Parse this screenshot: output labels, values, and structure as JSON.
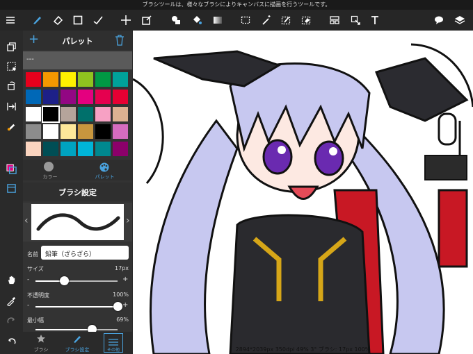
{
  "status_bar_top": {
    "message": "ブラシツールは、様々なブラシによりキャンバスに描画を行うツールです。"
  },
  "toolbar": {
    "icons": [
      "menu-icon",
      "brush-icon",
      "eraser-icon",
      "rectangle-icon",
      "smudge-icon",
      "move-icon",
      "transform-icon",
      "fill-shape-icon",
      "bucket-icon",
      "gradient-icon",
      "select-rect-icon",
      "magic-wand-icon",
      "select-pen-icon",
      "select-eraser-icon",
      "layout-icon",
      "select-move-icon",
      "text-icon",
      "speech-bubble-icon",
      "layers-icon"
    ]
  },
  "palette": {
    "title": "パレット",
    "name": "---",
    "colors": [
      "#e8001c",
      "#f39800",
      "#fff100",
      "#8fc31f",
      "#009944",
      "#00a29a",
      "#0068b7",
      "#1d2088",
      "#920783",
      "#e4007f",
      "#e5004f",
      "#e60033",
      "#ffffff",
      "#000000",
      "#b5a49b",
      "#00706b",
      "#f7a1c4",
      "#dcb192",
      "#8c8c8c",
      "#ffffff",
      "#fde89a",
      "#c8963e",
      "#000000",
      "#d56cbf",
      "#fbd5c0",
      "#004e55",
      "#00a3c0",
      "#00b5d8",
      "#00888f",
      "#8c006a"
    ],
    "tab_color": "カラー",
    "tab_palette": "パレット"
  },
  "brush_settings": {
    "title": "ブラシ設定",
    "name_label": "名前",
    "name_value": "鉛筆（ざらざら）",
    "size_label": "サイズ",
    "size_value": "17px",
    "size_level": 0.35,
    "opacity_label": "不透明度",
    "opacity_value": "100%",
    "opacity_level": 1.0,
    "min_width_label": "最小幅",
    "min_width_value": "69%",
    "min_width_level": 0.69,
    "minus": "-",
    "plus": "+"
  },
  "bottom_tabs": {
    "brush": "ブラシ",
    "brush_settings": "ブラシ設定",
    "third": "その他"
  },
  "status_bar_bottom": {
    "text": "2894*2039px 350dpi 49% 3° ブラシ: 17px 100%"
  },
  "colors": {
    "accent": "#4aa3df",
    "toolbar_bg": "#262626",
    "panel_bg": "#333333"
  }
}
